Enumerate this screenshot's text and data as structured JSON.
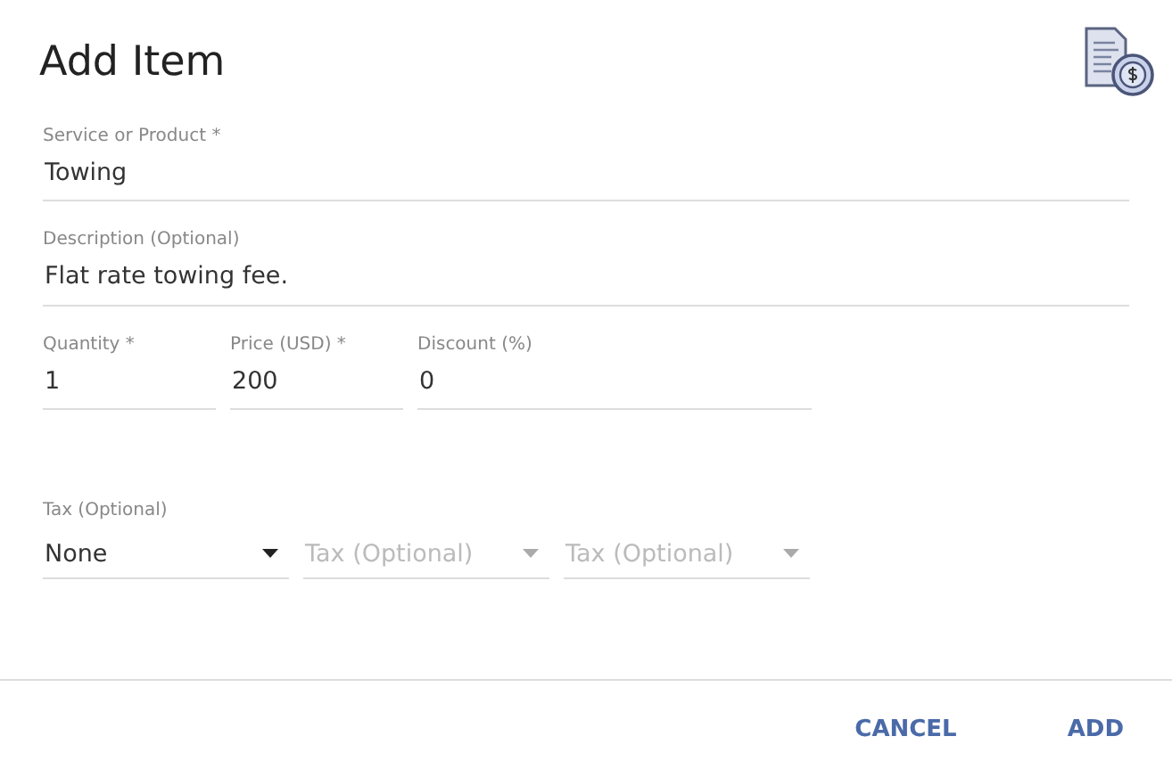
{
  "title": "Add Item",
  "fields": [
    {
      "label": "Service or Product *",
      "value": "Towing"
    },
    {
      "label": "Description (Optional)",
      "value": "Flat rate towing fee."
    }
  ],
  "amounts": [
    {
      "label": "Quantity *",
      "value": "1"
    },
    {
      "label": "Price (USD) *",
      "value": "200"
    },
    {
      "label": "Discount (%)",
      "value": "0"
    }
  ],
  "tax": {
    "label": "Tax (Optional)",
    "dropdowns": [
      {
        "value": "None",
        "disabled": false
      },
      {
        "placeholder": "Tax (Optional)",
        "disabled": true
      },
      {
        "placeholder": "Tax (Optional)",
        "disabled": true
      }
    ]
  },
  "buttons": [
    "CANCEL",
    "ADD"
  ]
}
